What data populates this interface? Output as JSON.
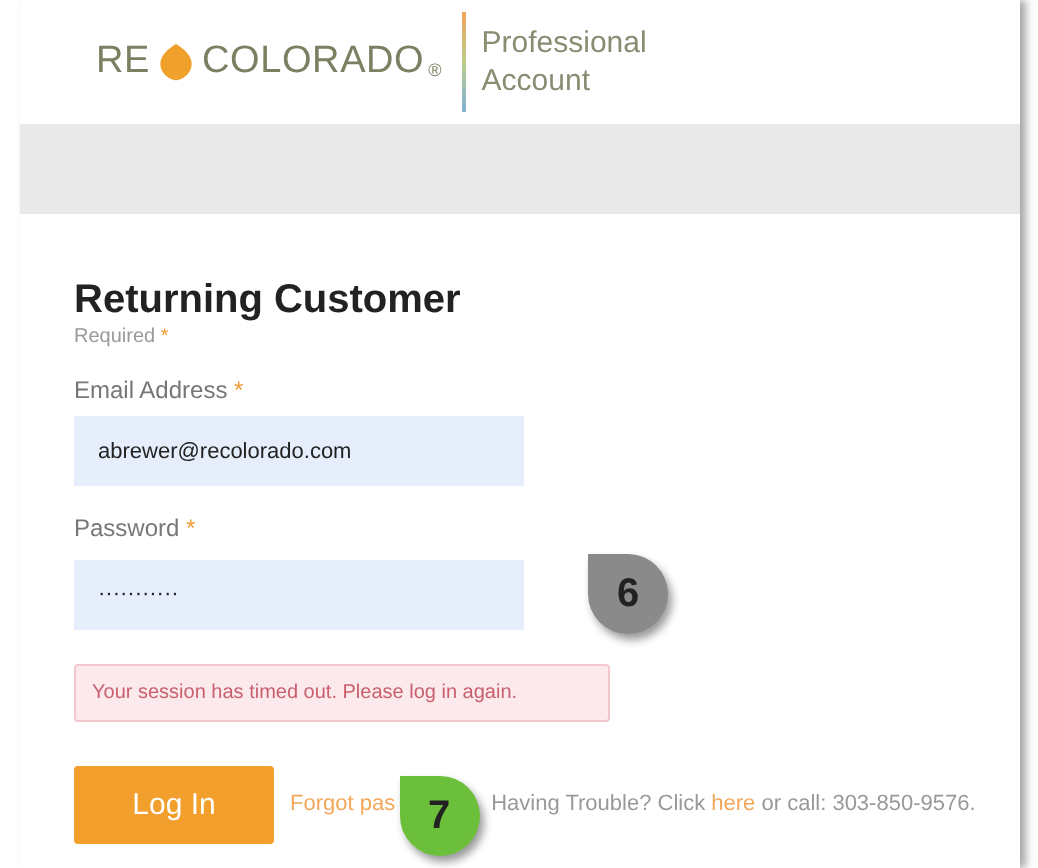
{
  "logo": {
    "left": "RE",
    "right": "COLORADO",
    "mark": "®"
  },
  "account": [
    "Professional",
    "Account"
  ],
  "form": {
    "title": "Returning Customer",
    "required_note": "Required",
    "required_mark": "*",
    "fields": [
      {
        "label": "Email Address",
        "value": "abrewer@recolorado.com"
      },
      {
        "label": "Password",
        "value": "···········"
      }
    ],
    "error": "Your session has timed out. Please log in again.",
    "button": "Log In",
    "forgot_link": "Forgot pas",
    "trouble": {
      "before": "Having Trouble? Click",
      "link": "here",
      "after": "or call: 303-850-9576."
    }
  },
  "callouts": [
    {
      "label": "6",
      "color": "#8a8a8a"
    },
    {
      "label": "7",
      "color": "#6cbf3a"
    }
  ]
}
